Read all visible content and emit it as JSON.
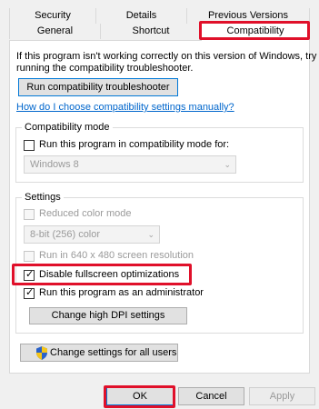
{
  "tabs": {
    "security": "Security",
    "details": "Details",
    "previous_versions": "Previous Versions",
    "general": "General",
    "shortcut": "Shortcut",
    "compatibility": "Compatibility"
  },
  "intro": {
    "line1": "If this program isn't working correctly on this version of Windows, try",
    "line2": "running the compatibility troubleshooter."
  },
  "troubleshooter_button": "Run compatibility troubleshooter",
  "manual_link": "How do I choose compatibility settings manually?",
  "compat_mode": {
    "title": "Compatibility mode",
    "checkbox_label": "Run this program in compatibility mode for:",
    "checked": false,
    "selected_os": "Windows 8"
  },
  "settings": {
    "title": "Settings",
    "reduced_color": "Reduced color mode",
    "color_depth": "8-bit (256) color",
    "run_640": "Run in 640 x 480 screen resolution",
    "disable_fullscreen": "Disable fullscreen optimizations",
    "run_admin": "Run this program as an administrator",
    "high_dpi_button": "Change high DPI settings"
  },
  "all_users_button": "Change settings for all users",
  "footer": {
    "ok": "OK",
    "cancel": "Cancel",
    "apply": "Apply"
  },
  "colors": {
    "annotation_red": "#e0102a",
    "link_blue": "#0066cc",
    "shield_blue": "#2a62c9",
    "shield_yellow": "#f5c518"
  },
  "icons": {
    "all_users_button": "uac-shield-icon",
    "checkmark": "checkmark-icon",
    "dropdown": "chevron-down-icon"
  }
}
